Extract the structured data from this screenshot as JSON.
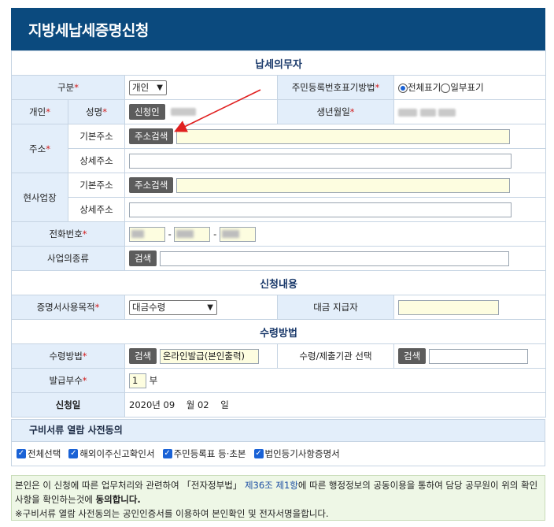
{
  "page": {
    "title": "지방세납세증명신청"
  },
  "sections": {
    "taxpayer": "납세의무자",
    "request": "신청내용",
    "receipt": "수령방법"
  },
  "taxpayer": {
    "category_label": "구분",
    "category_value": "개인",
    "rrn_method_label": "주민등록번호표기방법",
    "rrn_full": "전체표기",
    "rrn_partial": "일부표기",
    "person_label": "개인",
    "name_label": "성명",
    "applicant_button": "신청인",
    "birth_label": "생년월일",
    "address_label": "주소",
    "basic_address_label": "기본주소",
    "address_search_button": "주소검색",
    "detail_address_label": "상세주소",
    "business_label": "현사업장",
    "business_basic_label": "기본주소",
    "business_search_button": "주소검색",
    "business_detail_label": "상세주소",
    "phone_label": "전화번호",
    "phone_sep": "-",
    "business_type_label": "사업의종류",
    "business_type_search": "검색"
  },
  "request": {
    "purpose_label": "증명서사용목적",
    "purpose_value": "대금수령",
    "payer_label": "대금 지급자"
  },
  "receipt": {
    "method_label": "수령방법",
    "method_search": "검색",
    "method_value": "온라인발급(본인출력)",
    "agency_label": "수령/제출기관 선택",
    "agency_search": "검색",
    "copies_label": "발급부수",
    "copies_value": "1",
    "copies_unit": "부",
    "date_label": "신청일",
    "date_value": "2020년 09    월 02    일"
  },
  "consent": {
    "title": "구비서류 열람 사전동의",
    "items": [
      "전체선택",
      "해외이주신고확인서",
      "주민등록표 등·초본",
      "법인등기사항증명서"
    ]
  },
  "notice": {
    "line1_a": "본인은 이 신청에 따른 업무처리와 관련하여 「전자정부법」",
    "line1_link": "제36조 제1항",
    "line1_b": "에 따른 행정정보의 공동이용을 통하여 담당 공무원이 위의 확인",
    "line2_a": "사항을 확인하는것에 ",
    "line2_bold": "동의합니다.",
    "line3": "※구비서류 열람 사전동의는 공인인증서를 이용하여 본인확인 및 전자서명을합니다."
  },
  "colors": {
    "title_bg": "#0b4a7e",
    "label_bg": "#e3eefa",
    "required": "#d21a1a",
    "highlight_input": "#fdfde0",
    "arrow": "#e02020",
    "notice_bg": "#eef7e6"
  }
}
